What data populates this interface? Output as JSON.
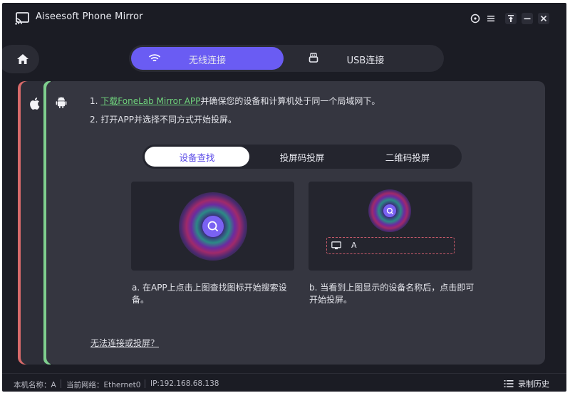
{
  "window": {
    "title": "Aiseesoft Phone Mirror"
  },
  "modes": {
    "wifi_label": "无线连接",
    "usb_label": "USB连接"
  },
  "instructions": {
    "step1_prefix": "1. ",
    "step1_link": "下载FoneLab Mirror APP",
    "step1_suffix": "并确保您的设备和计算机处于同一个局域网下。",
    "step2": "2. 打开APP并选择不同方式开始投屏。"
  },
  "sub_tabs": {
    "find": "设备查找",
    "pin": "投屏码投屏",
    "qr": "二维码投屏"
  },
  "cards": {
    "device_name": "A"
  },
  "captions": {
    "left": "a. 在APP上点击上图查找图标开始搜索设备。",
    "right": "b. 当看到上图显示的设备名称后，点击即可开始投屏。"
  },
  "help_link": "无法连接或投屏？",
  "status": {
    "device": "本机名称：A",
    "network": "当前网络：Ethernet0",
    "ip": "IP:192.168.68.138",
    "history": "录制历史"
  },
  "colors": {
    "accent": "#6a5cf3",
    "link": "#6fd27c",
    "panel": "#353640",
    "background": "#1b1c24"
  }
}
